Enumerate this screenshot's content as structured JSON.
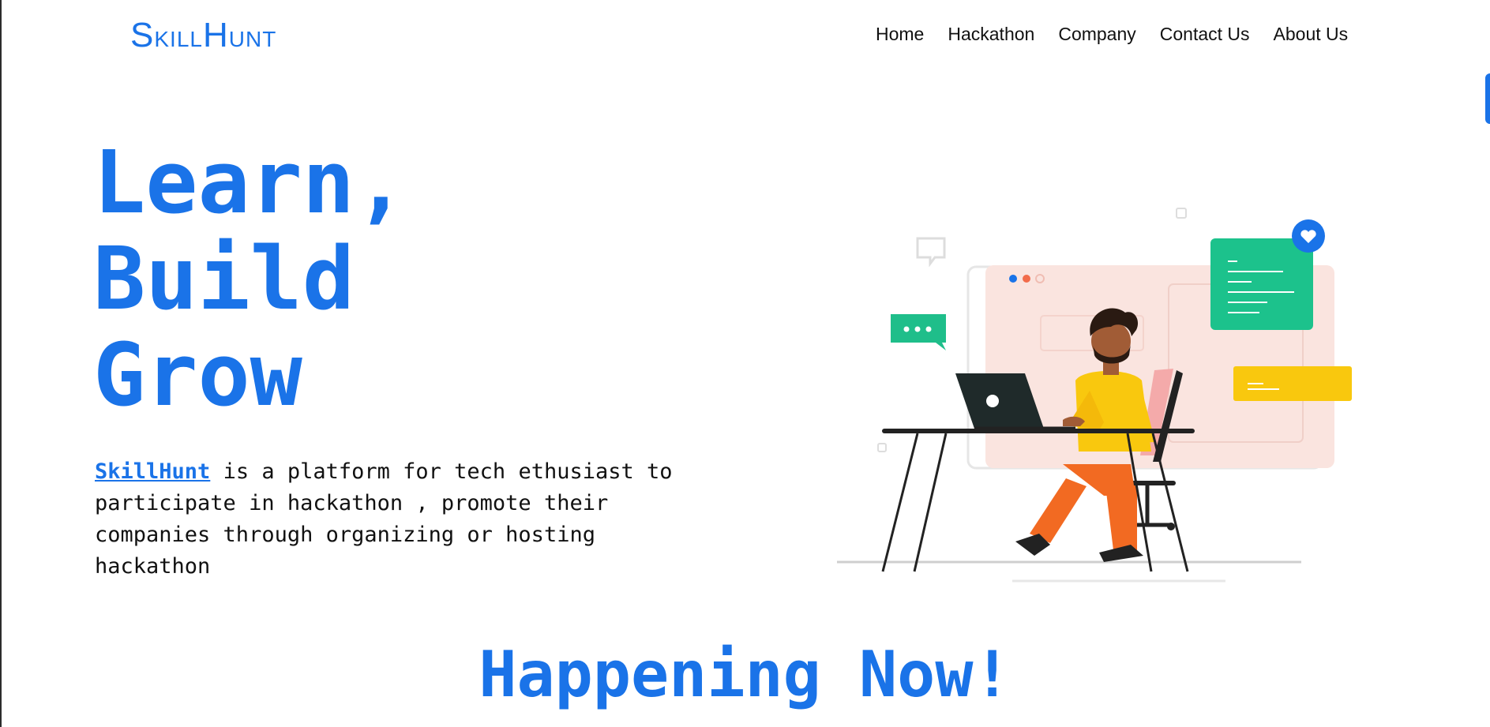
{
  "navbar": {
    "logo": {
      "first_cap": "S",
      "first_rest": "KILL",
      "second_cap": "H",
      "second_rest": "UNT"
    },
    "links": [
      "Home",
      "Hackathon",
      "Company",
      "Contact Us",
      "About Us"
    ]
  },
  "hero": {
    "title_lines": [
      "Learn,",
      "Build",
      "Grow"
    ],
    "brand_link": "SkillHunt",
    "description": " is a platform for tech ethusiast to participate in hackathon , promote their companies through organizing or hosting hackathon"
  },
  "section": {
    "title": "Happening Now!"
  },
  "colors": {
    "accent": "#1a73e8",
    "text": "#111111",
    "background": "#ffffff"
  },
  "illustration": {
    "icon": "person-working-at-laptop-illustration"
  }
}
